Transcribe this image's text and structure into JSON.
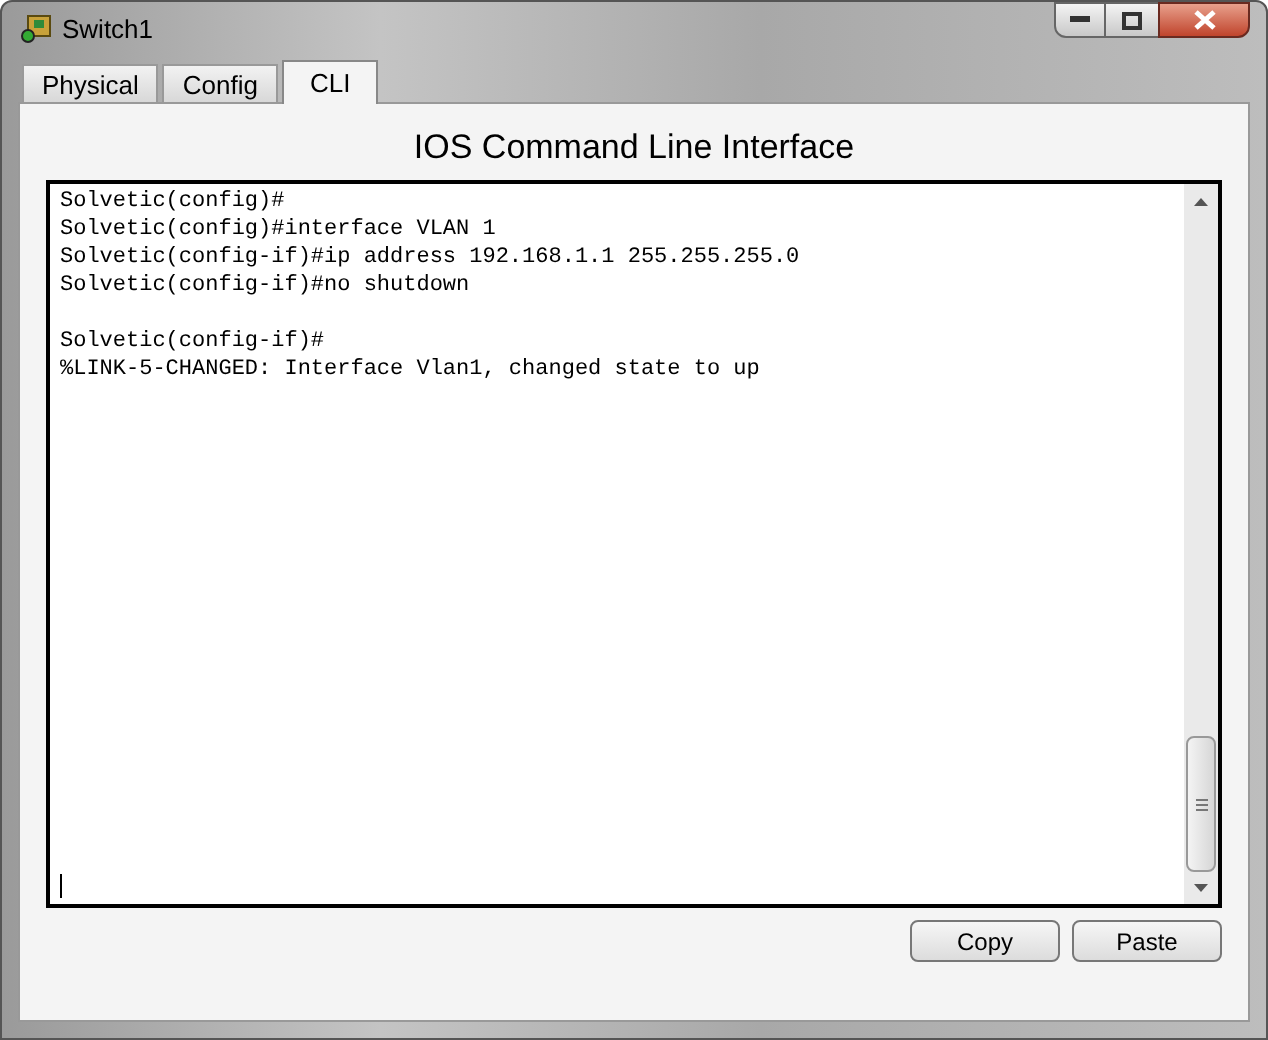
{
  "window": {
    "title": "Switch1"
  },
  "tabs": [
    {
      "label": "Physical",
      "selected": false
    },
    {
      "label": "Config",
      "selected": false
    },
    {
      "label": "CLI",
      "selected": true
    }
  ],
  "heading": "IOS Command Line Interface",
  "console": {
    "blocks": [
      [
        "Solvetic(config)#",
        "Solvetic(config)#interface VLAN 1",
        "Solvetic(config-if)#ip address 192.168.1.1 255.255.255.0",
        "Solvetic(config-if)#no shutdown"
      ],
      [
        "Solvetic(config-if)#",
        "%LINK-5-CHANGED: Interface Vlan1, changed state to up"
      ]
    ]
  },
  "buttons": [
    "Copy",
    "Paste"
  ]
}
